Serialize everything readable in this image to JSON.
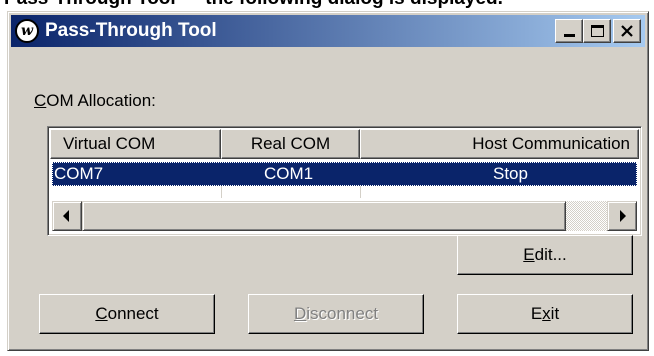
{
  "caption_fragment": "Pass-Through Tool — the following dialog is displayed.",
  "window": {
    "app_icon_glyph": "w",
    "title": "Pass-Through Tool",
    "caption_buttons": [
      "minimize-icon",
      "maximize-icon",
      "close-icon"
    ]
  },
  "com_allocation": {
    "label_prefix": "C",
    "label_rest": "OM Allocation:"
  },
  "list": {
    "columns": [
      "Virtual COM",
      "Real COM",
      "Host Communication"
    ],
    "rows": [
      {
        "virtual_com": "COM7",
        "real_com": "COM1",
        "host_communication": "Stop",
        "selected": true
      }
    ],
    "scroll_left_icon": "arrow-left-icon",
    "scroll_right_icon": "arrow-right-icon"
  },
  "buttons": {
    "edit": {
      "accel": "E",
      "rest": "dit..."
    },
    "connect": {
      "accel": "C",
      "rest": "onnect"
    },
    "disconnect": {
      "accel": "D",
      "rest": "isconnect",
      "enabled": false
    },
    "exit": {
      "pre": "E",
      "accel": "x",
      "rest": "it"
    }
  },
  "colors": {
    "face": "#d4d0c8",
    "title_start": "#0a246a",
    "title_end": "#a6caf0",
    "selection": "#0a246a"
  }
}
